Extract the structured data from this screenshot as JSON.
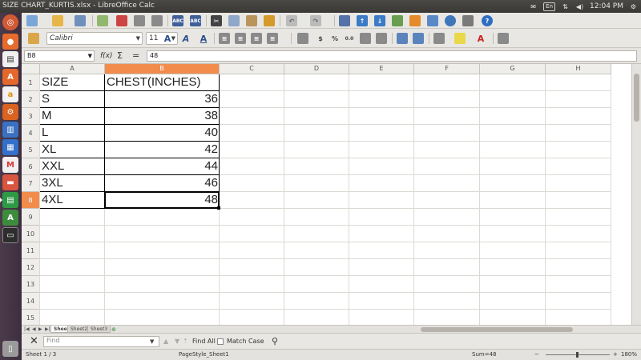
{
  "window": {
    "title": "SIZE CHART_KURTIS.xlsx - LibreOffice Calc"
  },
  "tray": {
    "keyboard_badge": "En",
    "time": "12:04 PM"
  },
  "toolbar": {
    "font_name": "Calibri",
    "font_size": "11"
  },
  "formula_bar": {
    "name_box": "B8",
    "fx_label": "f(x)",
    "sum_label": "Σ",
    "equals_label": "=",
    "content": "48"
  },
  "grid": {
    "columns": [
      "A",
      "B",
      "C",
      "D",
      "E",
      "F",
      "G",
      "H"
    ],
    "rows": [
      "1",
      "2",
      "3",
      "4",
      "5",
      "6",
      "7",
      "8",
      "9",
      "10",
      "11",
      "12",
      "13",
      "14",
      "15"
    ],
    "header_size": "SIZE",
    "header_chest": "CHEST(INCHES)",
    "table": [
      {
        "size": "S",
        "chest": "36"
      },
      {
        "size": "M",
        "chest": "38"
      },
      {
        "size": "L",
        "chest": "40"
      },
      {
        "size": "XL",
        "chest": "42"
      },
      {
        "size": "XXL",
        "chest": "44"
      },
      {
        "size": "3XL",
        "chest": "46"
      },
      {
        "size": "4XL",
        "chest": "48"
      }
    ],
    "selected_cell": "B8"
  },
  "sheets": [
    "Sheet1",
    "Sheet2",
    "Sheet3"
  ],
  "find_bar": {
    "placeholder": "Find",
    "find_all": "Find All",
    "match_case": "Match Case"
  },
  "status": {
    "sheet": "Sheet 1 / 3",
    "page_style": "PageStyle_Sheet1",
    "sum": "Sum=48",
    "zoom": "180%"
  }
}
